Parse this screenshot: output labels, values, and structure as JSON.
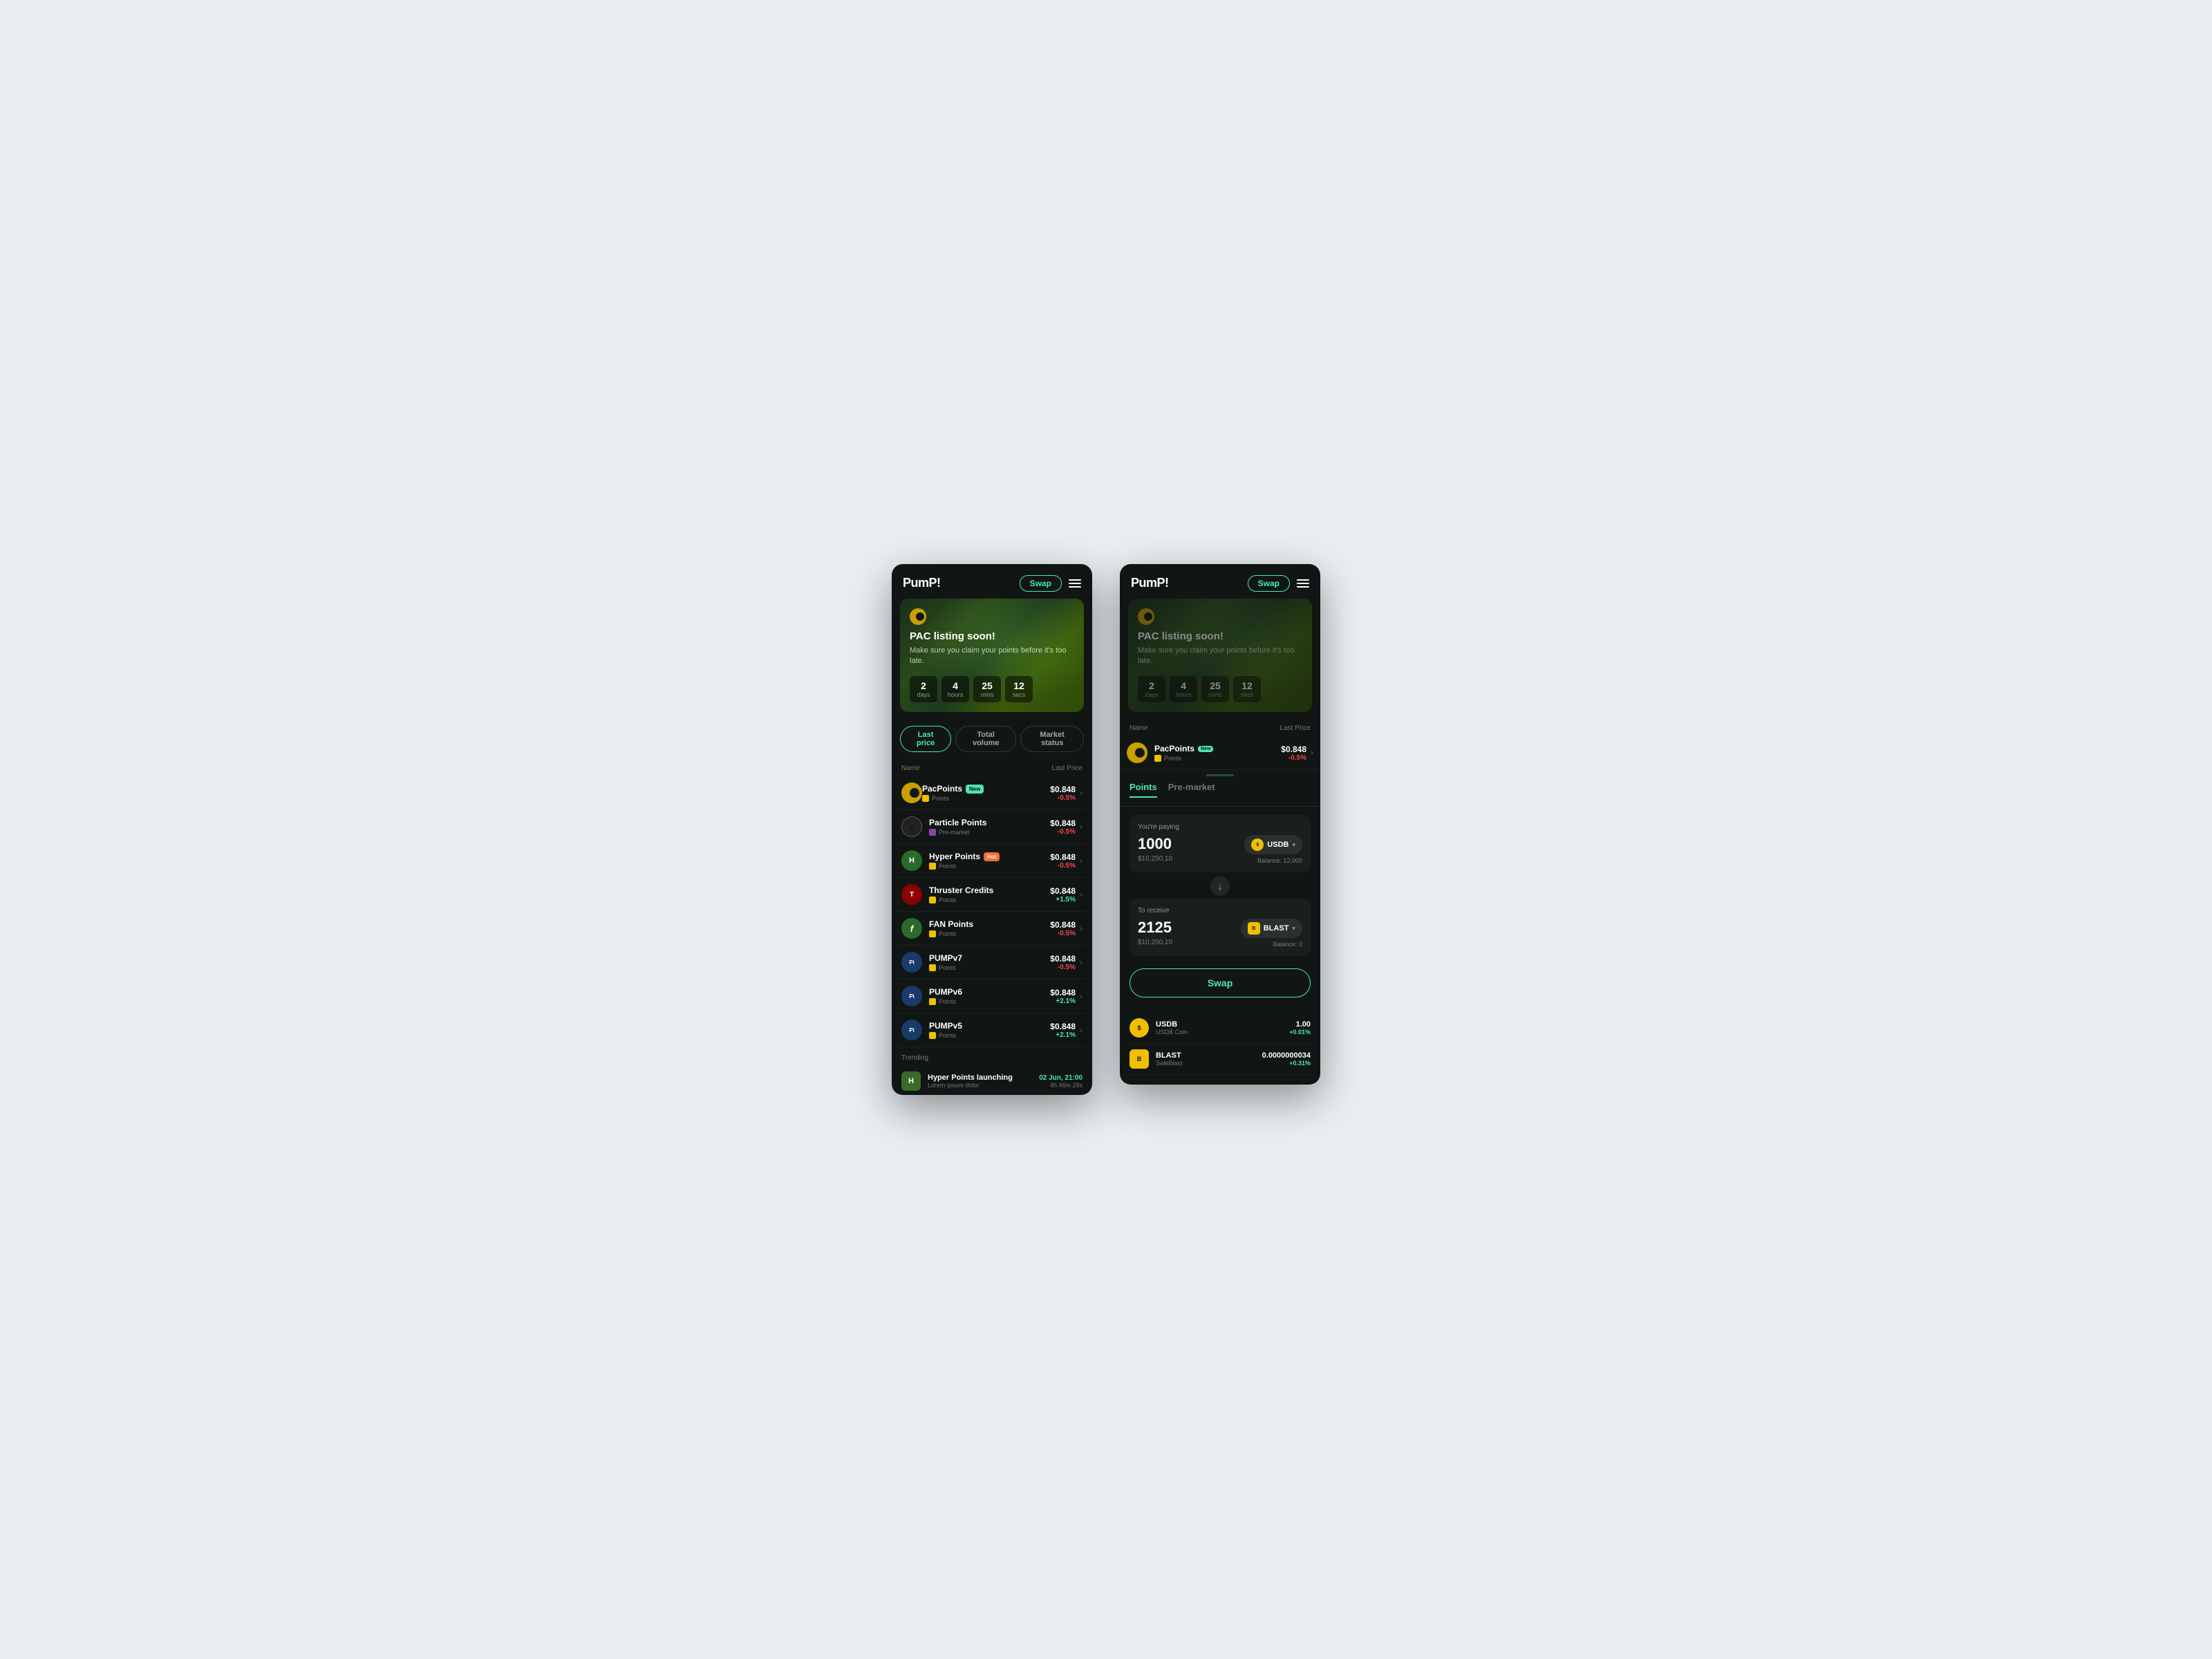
{
  "left_screen": {
    "header": {
      "logo": "PumP!",
      "swap_label": "Swap",
      "menu_aria": "Menu"
    },
    "banner": {
      "title": "PAC listing soon!",
      "subtitle": "Make sure you claim your points before it's too late.",
      "countdown": [
        {
          "value": "2",
          "label": "days"
        },
        {
          "value": "4",
          "label": "hours"
        },
        {
          "value": "25",
          "label": "mins"
        },
        {
          "value": "12",
          "label": "secs"
        }
      ]
    },
    "tabs": [
      {
        "label": "Last price",
        "active": true
      },
      {
        "label": "Total volume",
        "active": false
      },
      {
        "label": "Market status",
        "active": false
      }
    ],
    "table_header": {
      "name_col": "Name",
      "price_col": "Last Price"
    },
    "coins": [
      {
        "name": "PacPoints",
        "badge": "New",
        "badge_type": "new",
        "sub": "Points",
        "price": "$0.848",
        "change": "-0.5%",
        "change_type": "neg",
        "icon_color": "#c8a000",
        "icon_text": "C"
      },
      {
        "name": "Particle Points",
        "badge": "",
        "badge_type": "",
        "sub": "Pre-market",
        "price": "$0.848",
        "change": "-0.5%",
        "change_type": "neg",
        "icon_color": "#333",
        "icon_text": "○"
      },
      {
        "name": "Hyper Points",
        "badge": "Hot",
        "badge_type": "hot",
        "sub": "Points",
        "price": "$0.848",
        "change": "-0.5%",
        "change_type": "neg",
        "icon_color": "#2a6a2a",
        "icon_text": "H"
      },
      {
        "name": "Thruster Credits",
        "badge": "",
        "badge_type": "",
        "sub": "Points",
        "price": "$0.848",
        "change": "+1.5%",
        "change_type": "pos",
        "icon_color": "#8B0000",
        "icon_text": "T"
      },
      {
        "name": "FAN Points",
        "badge": "",
        "badge_type": "",
        "sub": "Points",
        "price": "$0.848",
        "change": "-0.5%",
        "change_type": "neg",
        "icon_color": "#2a6a2a",
        "icon_text": "f"
      },
      {
        "name": "PUMPv7",
        "badge": "",
        "badge_type": "",
        "sub": "Points",
        "price": "$0.848",
        "change": "-0.5%",
        "change_type": "neg",
        "icon_color": "#1a3a5a",
        "icon_text": "Pi"
      },
      {
        "name": "PUMPv6",
        "badge": "",
        "badge_type": "",
        "sub": "Points",
        "price": "$0.848",
        "change": "+2.1%",
        "change_type": "pos",
        "icon_color": "#1a3a5a",
        "icon_text": "Pi"
      },
      {
        "name": "PUMPv5",
        "badge": "",
        "badge_type": "",
        "sub": "Points",
        "price": "$0.848",
        "change": "+2.1%",
        "change_type": "pos",
        "icon_color": "#1a3a5a",
        "icon_text": "Pi"
      }
    ],
    "trending": {
      "title": "Trending",
      "items": [
        {
          "name": "Hyper Points launching",
          "desc": "Lorem ipsum dolor",
          "date": "02 Jun, 21:00",
          "time": "4h 46m 29s",
          "icon_color": "#2a6a2a",
          "icon_text": "H"
        }
      ]
    }
  },
  "right_screen": {
    "header": {
      "logo": "PumP!",
      "swap_label": "Swap",
      "menu_aria": "Menu"
    },
    "banner": {
      "title": "PAC listing soon!",
      "subtitle": "Make sure you claim your points before it's too late.",
      "countdown": [
        {
          "value": "2",
          "label": "days"
        },
        {
          "value": "4",
          "label": "hours"
        },
        {
          "value": "25",
          "label": "mins"
        },
        {
          "value": "12",
          "label": "secs"
        }
      ]
    },
    "table_header": {
      "name_col": "Name",
      "price_col": "Last Price"
    },
    "partial_coin": {
      "name": "PacPoints",
      "badge": "New",
      "sub": "Points",
      "price": "$0.848",
      "change": "-0.5%",
      "change_type": "neg"
    },
    "swap_panel": {
      "tabs": [
        {
          "label": "Points",
          "active": true
        },
        {
          "label": "Pre-market",
          "active": false
        }
      ],
      "paying": {
        "label": "You're paying",
        "amount": "1000",
        "usd": "$10,250.10",
        "token": "USDB",
        "balance": "Balance: 12,000"
      },
      "receiving": {
        "label": "To receive",
        "amount": "2125",
        "usd": "$10,250.10",
        "token": "BLAST",
        "balance": "Balance: 0"
      },
      "swap_button": "Swap"
    },
    "bottom_tokens": [
      {
        "name": "USDB",
        "sub": "USDB Coin",
        "price": "1.00",
        "change": "+0.01%",
        "change_type": "pos",
        "icon_color": "#f0c000"
      },
      {
        "name": "BLAST",
        "sub": "SafeBlast",
        "price": "0.0000000034",
        "change": "+0.31%",
        "change_type": "pos",
        "icon_color": "#f0c000"
      }
    ]
  }
}
